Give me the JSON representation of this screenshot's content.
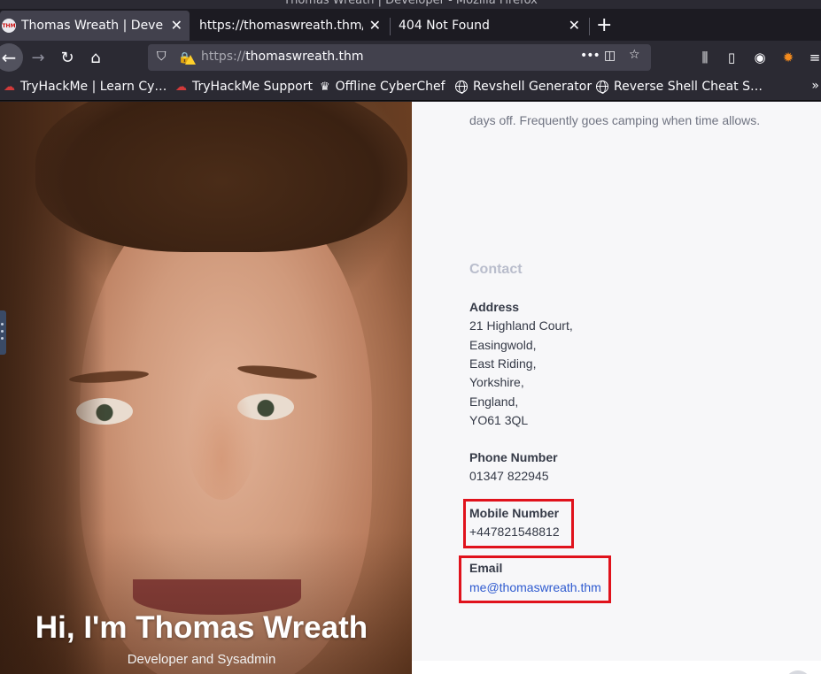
{
  "window": {
    "title": "Thomas Wreath | Developer - Mozilla Firefox"
  },
  "tabs": [
    {
      "label": "Thomas Wreath | Developer",
      "active": true,
      "favicon": "tryhackme-favicon"
    },
    {
      "label": "https://thomaswreath.thm/",
      "active": false
    },
    {
      "label": "404 Not Found",
      "active": false
    }
  ],
  "tab_close_glyph": "✕",
  "new_tab_glyph": "+",
  "navbar": {
    "back_icon": "back-arrow-icon",
    "url_scheme": "https://",
    "url_host": "thomaswreath.thm",
    "more_glyph": "•••"
  },
  "bookmarks": [
    {
      "label": "TryHackMe | Learn Cy…",
      "icon": "tryhackme-cloud-icon"
    },
    {
      "label": "TryHackMe Support",
      "icon": "tryhackme-cloud-icon"
    },
    {
      "label": "Offline CyberChef",
      "icon": "chef-hat-icon"
    },
    {
      "label": "Revshell Generator",
      "icon": "globe-icon"
    },
    {
      "label": "Reverse Shell Cheat S…",
      "icon": "globe-icon"
    }
  ],
  "bookmarks_overflow": "»",
  "page": {
    "intro_tail": "days off. Frequently goes camping when time allows.",
    "hero_name": "Hi, I'm Thomas Wreath",
    "hero_role": "Developer and Sysadmin",
    "contact_heading": "Contact",
    "address_label": "Address",
    "address_lines": [
      "21 Highland Court,",
      "Easingwold,",
      "East Riding,",
      "Yorkshire,",
      "England,",
      "YO61 3QL"
    ],
    "phone_label": "Phone Number",
    "phone_value": "01347 822945",
    "mobile_label": "Mobile Number",
    "mobile_value": "+447821548812",
    "email_label": "Email",
    "email_value": "me@thomaswreath.thm"
  },
  "colors": {
    "highlight_box": "#e0121c",
    "link": "#2f5bd0",
    "contact_heading": "#b9bdcc"
  }
}
